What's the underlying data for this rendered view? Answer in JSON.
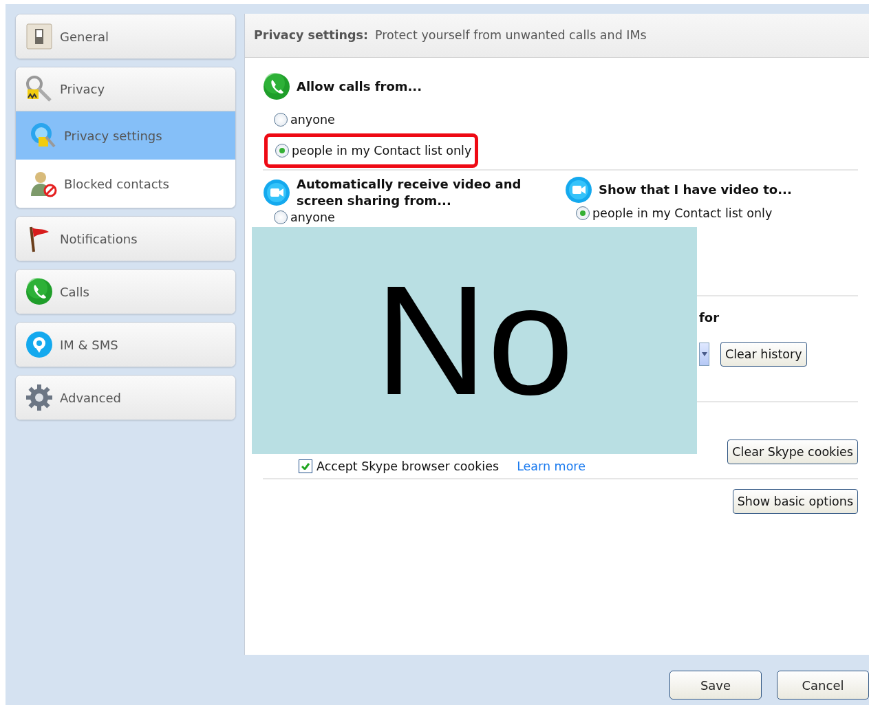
{
  "sidebar": {
    "groups": [
      {
        "label": "General",
        "expanded": false
      },
      {
        "label": "Privacy",
        "expanded": true,
        "children": [
          {
            "label": "Privacy settings",
            "selected": true
          },
          {
            "label": "Blocked contacts",
            "selected": false
          }
        ]
      },
      {
        "label": "Notifications",
        "expanded": false
      },
      {
        "label": "Calls",
        "expanded": false
      },
      {
        "label": "IM & SMS",
        "expanded": false
      },
      {
        "label": "Advanced",
        "expanded": false
      }
    ]
  },
  "header": {
    "title": "Privacy settings:",
    "subtitle": "Protect yourself from unwanted calls and IMs"
  },
  "calls": {
    "heading": "Allow calls from...",
    "options": [
      {
        "label": "anyone",
        "selected": false,
        "highlighted": false
      },
      {
        "label": "people in my Contact list only",
        "selected": true,
        "highlighted": true
      }
    ]
  },
  "video_receive": {
    "heading": "Automatically receive video and screen sharing from...",
    "options": [
      {
        "label": "anyone",
        "selected": false
      }
    ]
  },
  "video_show": {
    "heading": "Show that I have video to...",
    "options": [
      {
        "label": "people in my Contact list only",
        "selected": true
      }
    ]
  },
  "history": {
    "heading": "for",
    "button": "Clear history"
  },
  "cookies": {
    "checkbox": {
      "label": "Accept Skype browser cookies",
      "checked": true
    },
    "link": "Learn more",
    "button": "Clear Skype cookies"
  },
  "options_button": "Show basic options",
  "footer_buttons": [
    "Save",
    "Cancel"
  ],
  "overlay": {
    "text": "No"
  }
}
